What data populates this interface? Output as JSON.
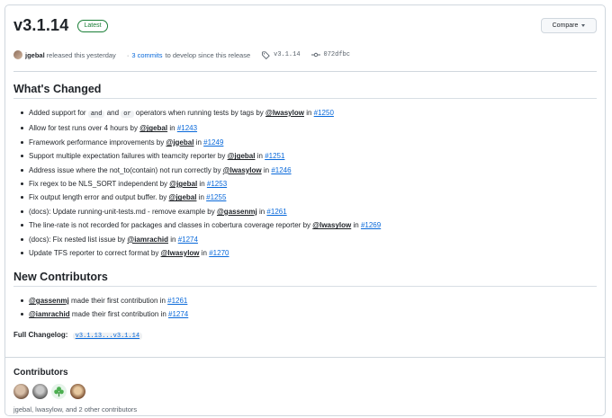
{
  "release": {
    "version": "v3.1.14",
    "latest_badge": "Latest",
    "compare_label": "Compare",
    "author": "jgebal",
    "released_text": "released this yesterday",
    "commits_prefix": "·",
    "commits_link": "3 commits",
    "commits_suffix": "to develop since this release",
    "tag": "v3.1.14",
    "commit_hash": "072dfbc"
  },
  "whats_changed": {
    "heading": "What's Changed",
    "items": [
      {
        "pre": "Added support for",
        "code1": "and",
        "mid": "and",
        "code2": "or",
        "post": "operators when running tests by tags by",
        "user": "@lwasylow",
        "in": "in",
        "pr": "#1250"
      },
      {
        "pre": "Allow for test runs over 4 hours by",
        "user": "@jgebal",
        "in": "in",
        "pr": "#1243"
      },
      {
        "pre": "Framework performance improvements by",
        "user": "@jgebal",
        "in": "in",
        "pr": "#1249"
      },
      {
        "pre": "Support multiple expectation failures with teamcity reporter by",
        "user": "@jgebal",
        "in": "in",
        "pr": "#1251"
      },
      {
        "pre": "Address issue where the not_to(contain) not run correctly by",
        "user": "@lwasylow",
        "in": "in",
        "pr": "#1246"
      },
      {
        "pre": "Fix regex to be NLS_SORT independent by",
        "user": "@jgebal",
        "in": "in",
        "pr": "#1253"
      },
      {
        "pre": "Fix output length error and output buffer. by",
        "user": "@jgebal",
        "in": "in",
        "pr": "#1255"
      },
      {
        "pre": "(docs): Update running-unit-tests.md - remove example by",
        "user": "@gassenmj",
        "in": "in",
        "pr": "#1261"
      },
      {
        "pre": "The line-rate is not recorded for packages and classes in cobertura coverage reporter by",
        "user": "@lwasylow",
        "in": "in",
        "pr": "#1269"
      },
      {
        "pre": "(docs): Fix nested list issue by",
        "user": "@iamrachid",
        "in": "in",
        "pr": "#1274"
      },
      {
        "pre": "Update TFS reporter to correct format by",
        "user": "@lwasylow",
        "in": "in",
        "pr": "#1270"
      }
    ]
  },
  "new_contributors": {
    "heading": "New Contributors",
    "items": [
      {
        "user": "@gassenmj",
        "text": "made their first contribution in",
        "pr": "#1261"
      },
      {
        "user": "@iamrachid",
        "text": "made their first contribution in",
        "pr": "#1274"
      }
    ]
  },
  "changelog": {
    "label": "Full Changelog:",
    "link": "v3.1.13...v3.1.14"
  },
  "contributors": {
    "heading": "Contributors",
    "summary": "jgebal, lwasylow, and 2 other contributors"
  },
  "colors": {
    "link": "#0969da",
    "latest_badge": "#1a7f37",
    "border": "#d0d7de"
  }
}
